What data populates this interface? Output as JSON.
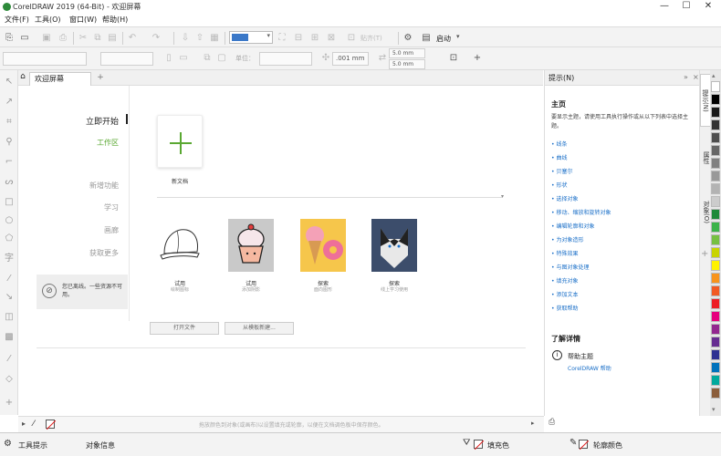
{
  "app": {
    "title": "CorelDRAW 2019 (64-Bit) - 欢迎屏幕"
  },
  "window": {
    "minimize": "—",
    "maximize": "☐",
    "close": "✕"
  },
  "menu": [
    "文件(F)",
    "工具(O)",
    "窗口(W)",
    "帮助(H)"
  ],
  "toolbar": {
    "launch_label": "启动",
    "zoom_value": "",
    "align_label": "贴齐(T)"
  },
  "propbar": {
    "unit_label": "单位：",
    "nudge": ".001 mm",
    "dup_x": "5.0 mm",
    "dup_y": "5.0 mm"
  },
  "tabs": {
    "welcome": "欢迎屏幕",
    "add": "+"
  },
  "welcome": {
    "nav": {
      "get_started": "立即开始",
      "workspace": "工作区",
      "whats_new": "新增功能",
      "learn": "学习",
      "gallery": "画廊",
      "get_more": "获取更多"
    },
    "offline_message": "您已离线。一些资源不可用。",
    "new_doc_label": "新文档",
    "recent": [
      {
        "title": "试用",
        "subtitle": "绘制图标"
      },
      {
        "title": "试用",
        "subtitle": "添加阴影"
      },
      {
        "title": "探索",
        "subtitle": "面向图形"
      },
      {
        "title": "探索",
        "subtitle": "线上学习使用"
      }
    ],
    "open_file_button": "打开文件",
    "open_template_button": "从模板新建..."
  },
  "hints": {
    "header": "提示(N)",
    "heading": "主页",
    "intro": "要显示主题，请使用工具执行操作或从以下列表中选择主题。",
    "links": [
      "线条",
      "曲线",
      "贝塞尔",
      "形状",
      "选择对象",
      "移动、缩放和旋转对象",
      "编辑轮廓和对象",
      "为对象造形",
      "特殊效果",
      "与图对象处理",
      "填充对象",
      "添加文本",
      "获取帮助"
    ],
    "learn_more": "了解详情",
    "help_topics": "帮助主题",
    "help_link": "CorelDRAW 帮助"
  },
  "docker_tabs": [
    "提示(N)",
    "属性",
    "对象(O)"
  ],
  "palette_colors": [
    "#ffffff",
    "#000000",
    "#1a1a1a",
    "#333333",
    "#4d4d4d",
    "#666666",
    "#808080",
    "#999999",
    "#b3b3b3",
    "#cccccc",
    "#1f8a3a",
    "#3bb34a",
    "#76c043",
    "#c8d400",
    "#fff200",
    "#f7941d",
    "#f15a24",
    "#ed1c24",
    "#e6007e",
    "#92278f",
    "#662d91",
    "#2e3192",
    "#0072bc",
    "#00a99d",
    "#8b5e3c"
  ],
  "docnav": {
    "hint": "拖放颜色到对象(或画布)以设置填充或轮廓，以便在文档调色板中保存颜色。"
  },
  "status": {
    "tool_hint": "工具提示",
    "object_info": "对象信息",
    "fill_label": "填充色",
    "outline_label": "轮廓颜色"
  }
}
